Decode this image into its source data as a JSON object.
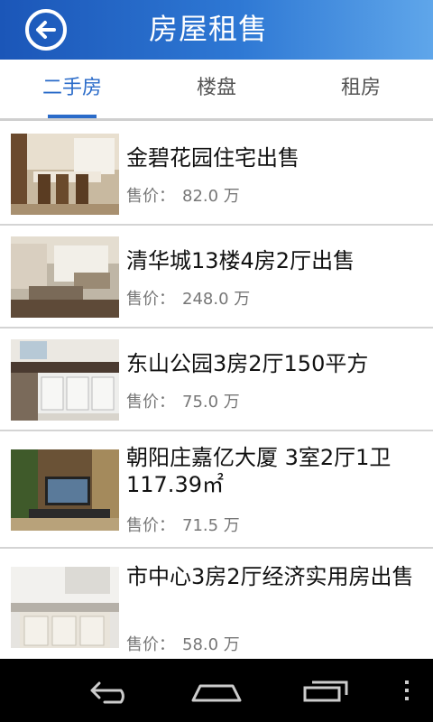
{
  "header": {
    "title": "房屋租售",
    "back_icon": "back-arrow-icon"
  },
  "tabs": [
    {
      "label": "二手房",
      "active": true
    },
    {
      "label": "楼盘",
      "active": false
    },
    {
      "label": "租房",
      "active": false
    }
  ],
  "listings": [
    {
      "title": "金碧花园住宅出售",
      "price_label": "售价：",
      "price": "82.0 万"
    },
    {
      "title": "清华城13楼4房2厅出售",
      "price_label": "售价：",
      "price": "248.0 万"
    },
    {
      "title": "东山公园3房2厅150平方",
      "price_label": "售价：",
      "price": "75.0 万"
    },
    {
      "title": "朝阳庄嘉亿大厦 3室2厅1卫117.39㎡",
      "price_label": "售价：",
      "price": "71.5 万"
    },
    {
      "title": "市中心3房2厅经济实用房出售",
      "price_label": "售价：",
      "price": "58.0 万"
    }
  ],
  "colors": {
    "header_start": "#1b56b8",
    "header_end": "#5fa6ea",
    "accent": "#2a6bc9"
  },
  "navbar": {
    "icons": [
      "back-nav-icon",
      "home-nav-icon",
      "recent-apps-icon",
      "overflow-menu-icon"
    ]
  }
}
